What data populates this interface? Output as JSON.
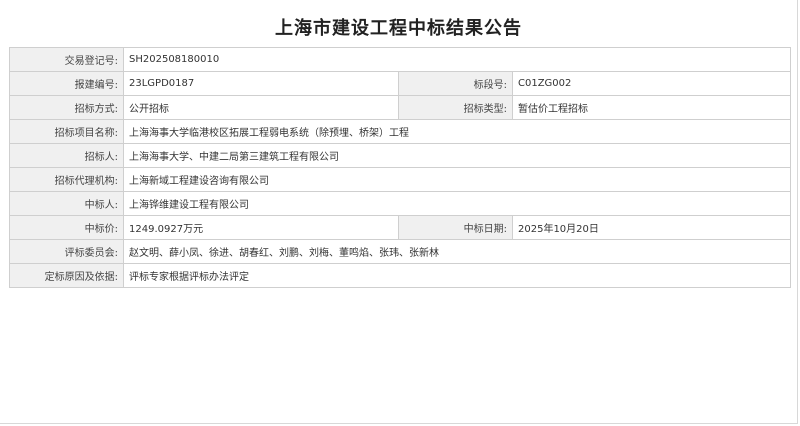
{
  "title": "上海市建设工程中标结果公告",
  "rows": {
    "trade_reg_no": {
      "label": "交易登记号:",
      "value": "SH202508180010"
    },
    "report_no": {
      "label": "报建编号:",
      "value": "23LGPD0187"
    },
    "section_no": {
      "label": "标段号:",
      "value": "C01ZG002"
    },
    "bid_method": {
      "label": "招标方式:",
      "value": "公开招标"
    },
    "bid_type": {
      "label": "招标类型:",
      "value": "暂估价工程招标"
    },
    "project_name": {
      "label": "招标项目名称:",
      "value": "上海海事大学临港校区拓展工程弱电系统（除预埋、桥架）工程"
    },
    "tenderer": {
      "label": "招标人:",
      "value": "上海海事大学、中建二局第三建筑工程有限公司"
    },
    "agency": {
      "label": "招标代理机构:",
      "value": "上海新域工程建设咨询有限公司"
    },
    "winner": {
      "label": "中标人:",
      "value": "上海铧维建设工程有限公司"
    },
    "price": {
      "label": "中标价:",
      "value": "1249.0927万元"
    },
    "date": {
      "label": "中标日期:",
      "value": "2025年10月20日"
    },
    "committee": {
      "label": "评标委员会:",
      "value": "赵文明、薛小凤、徐进、胡春红、刘鹏、刘梅、董鸣焰、张玮、张新林"
    },
    "reason": {
      "label": "定标原因及依据:",
      "value": "评标专家根据评标办法评定"
    }
  }
}
